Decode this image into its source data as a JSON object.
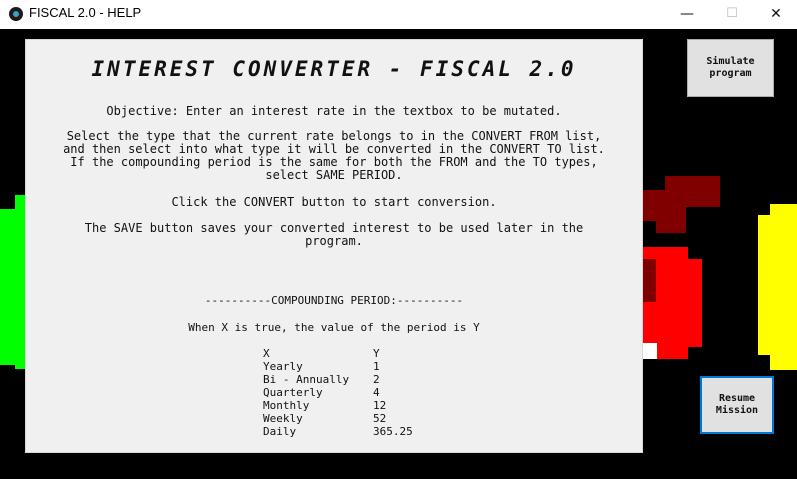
{
  "window": {
    "title": "FISCAL 2.0 - HELP",
    "min_icon": "minimize-icon",
    "max_icon": "maximize-icon",
    "close_icon": "close-icon",
    "min_glyph": "—",
    "max_glyph": "☐",
    "close_glyph": "✕"
  },
  "help": {
    "title": "INTEREST CONVERTER - FISCAL 2.0",
    "objective": "Objective: Enter an interest rate in the textbox to be mutated.",
    "instructions": "Select the type that the current rate belongs to in the CONVERT FROM list,\nand then select into what type it will be converted in the CONVERT TO list.\nIf the compounding period is the same for both the FROM and the TO types,\nselect SAME PERIOD.",
    "convert_note": "Click the CONVERT button to start conversion.",
    "save_note": "The SAVE button saves your converted interest to be used later in the\nprogram.",
    "section_heading": "----------COMPOUNDING PERIOD:----------",
    "section_desc": "When X is true, the value of the period is Y",
    "table_header": {
      "x": "X",
      "y": "Y"
    },
    "table_rows": [
      {
        "x": "Yearly",
        "y": "1"
      },
      {
        "x": "Bi - Annually",
        "y": "2"
      },
      {
        "x": "Quarterly",
        "y": "4"
      },
      {
        "x": "Monthly",
        "y": "12"
      },
      {
        "x": "Weekly",
        "y": "52"
      },
      {
        "x": "Daily",
        "y": "365.25"
      }
    ]
  },
  "buttons": {
    "simulate": "Simulate\nprogram",
    "resume": "Resume\nMission"
  },
  "colors": {
    "green": "#00ff00",
    "yellow": "#ffff00",
    "red": "#ff0000",
    "dark_red": "#800000",
    "panel": "#f0f0f0",
    "focus_border": "#0078d7"
  }
}
